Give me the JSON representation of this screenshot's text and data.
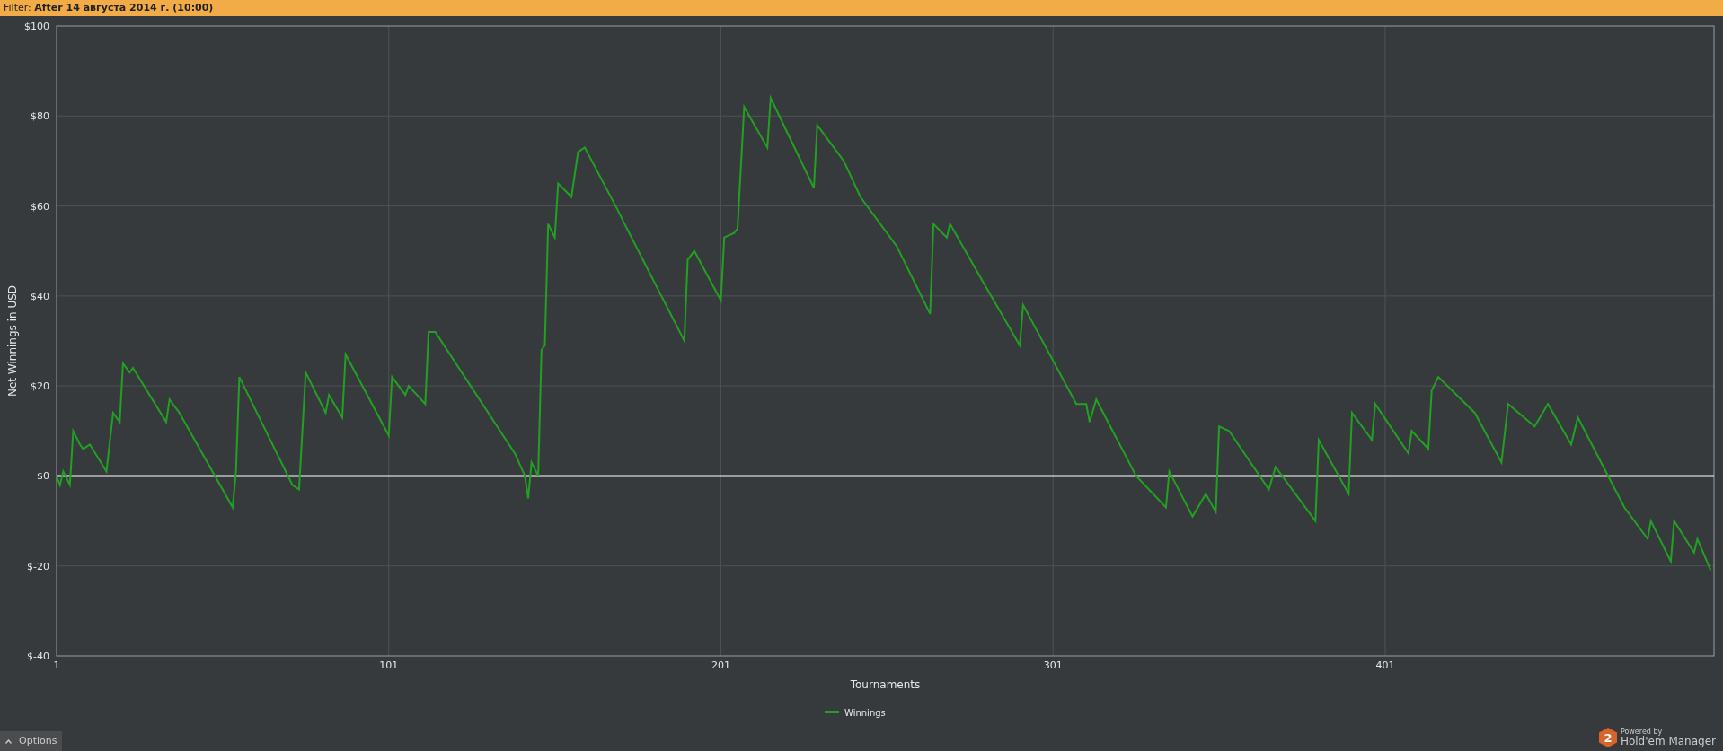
{
  "filter_bar": {
    "text": "Filter: **After 14 августа 2014 г. (10:00)**"
  },
  "chart": {
    "chart_data": {
      "type": "line",
      "grid": true,
      "xlabel": "Tournaments",
      "ylabel": "Net Winnings in USD",
      "xlim": [
        1,
        500
      ],
      "ylim": [
        -40,
        100
      ],
      "xticks": [
        1,
        101,
        201,
        301,
        401
      ],
      "yticks": [
        {
          "value": 100,
          "label": "$100"
        },
        {
          "value": 80,
          "label": "$80"
        },
        {
          "value": 60,
          "label": "$60"
        },
        {
          "value": 40,
          "label": "$40"
        },
        {
          "value": 20,
          "label": "$20"
        },
        {
          "value": 0,
          "label": "$0"
        },
        {
          "value": -20,
          "label": "$-20"
        },
        {
          "value": -40,
          "label": "$-40"
        }
      ],
      "x": [
        1,
        2,
        3,
        5,
        6,
        8,
        9,
        11,
        16,
        18,
        20,
        21,
        23,
        24,
        34,
        35,
        38,
        54,
        55,
        56,
        72,
        74,
        76,
        82,
        83,
        87,
        88,
        101,
        102,
        106,
        107,
        112,
        113,
        115,
        139,
        142,
        143,
        144,
        146,
        147,
        148,
        149,
        151,
        152,
        156,
        158,
        160,
        170,
        172,
        190,
        191,
        193,
        201,
        202,
        205,
        206,
        208,
        215,
        216,
        229,
        230,
        238,
        243,
        254,
        264,
        265,
        269,
        270,
        280,
        291,
        292,
        308,
        311,
        312,
        314,
        326,
        335,
        336,
        343,
        347,
        350,
        351,
        354,
        366,
        368,
        380,
        381,
        390,
        391,
        397,
        398,
        408,
        409,
        414,
        415,
        417,
        428,
        436,
        438,
        446,
        450,
        457,
        459,
        473,
        480,
        481,
        487,
        488,
        494,
        495,
        499
      ],
      "series": [
        {
          "name": "Winnings",
          "color": "#22a022",
          "values": [
            0,
            -2,
            1,
            -2,
            10,
            7,
            6,
            7,
            1,
            14,
            12,
            25,
            23,
            24,
            12,
            17,
            14,
            -7,
            1,
            22,
            -2,
            -3,
            23,
            14,
            18,
            13,
            27,
            9,
            22,
            18,
            20,
            16,
            32,
            32,
            5,
            0,
            -5,
            3,
            0,
            28,
            29,
            56,
            53,
            65,
            62,
            72,
            73,
            59,
            56,
            30,
            48,
            50,
            39,
            53,
            54,
            55,
            82,
            73,
            84,
            64,
            78,
            70,
            62,
            51,
            36,
            56,
            53,
            56,
            43,
            29,
            38,
            16,
            16,
            12,
            17,
            0,
            -7,
            1,
            -9,
            -4,
            -8,
            11,
            10,
            -3,
            2,
            -10,
            8,
            -4,
            14,
            8,
            16,
            5,
            10,
            6,
            19,
            22,
            14,
            3,
            16,
            11,
            16,
            7,
            13,
            -7,
            -14,
            -10,
            -19,
            -10,
            -17,
            -14,
            -21
          ]
        }
      ]
    }
  },
  "options_button": {
    "label": "Options"
  },
  "branding": {
    "badge": "2",
    "powered": "Powered by",
    "product": "Hold'em Manager"
  }
}
